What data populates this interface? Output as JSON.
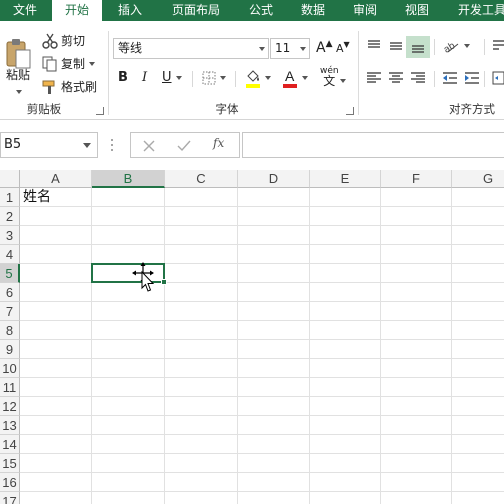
{
  "tabs": [
    {
      "label": "文件"
    },
    {
      "label": "开始"
    },
    {
      "label": "插入"
    },
    {
      "label": "页面布局"
    },
    {
      "label": "公式"
    },
    {
      "label": "数据"
    },
    {
      "label": "审阅"
    },
    {
      "label": "视图"
    },
    {
      "label": "开发工具"
    }
  ],
  "active_tab": "开始",
  "clipboard": {
    "paste_label": "粘贴",
    "cut_label": "剪切",
    "copy_label": "复制",
    "format_painter_label": "格式刷",
    "group_label": "剪贴板"
  },
  "font": {
    "font_name": "等线",
    "font_size": "11",
    "bold": "B",
    "italic": "I",
    "underline": "U",
    "grow": "A",
    "shrink": "A",
    "phonetic": "wén",
    "phonetic_char": "文",
    "group_label": "字体",
    "highlight_color": "#ffff00",
    "font_color": "#ff0000"
  },
  "alignment": {
    "group_label": "对齐方式"
  },
  "formula_bar": {
    "name_box": "B5",
    "fx": "fx",
    "content": ""
  },
  "grid": {
    "columns": [
      "A",
      "B",
      "C",
      "D",
      "E",
      "F",
      "G"
    ],
    "rows": [
      "1",
      "2",
      "3",
      "4",
      "5",
      "6",
      "7",
      "8",
      "9",
      "10",
      "11",
      "12",
      "13",
      "14",
      "15",
      "16",
      "17"
    ],
    "selected_column": "B",
    "selected_row": "5",
    "cells": {
      "A1": "姓名"
    }
  },
  "colors": {
    "accent": "#217346"
  }
}
